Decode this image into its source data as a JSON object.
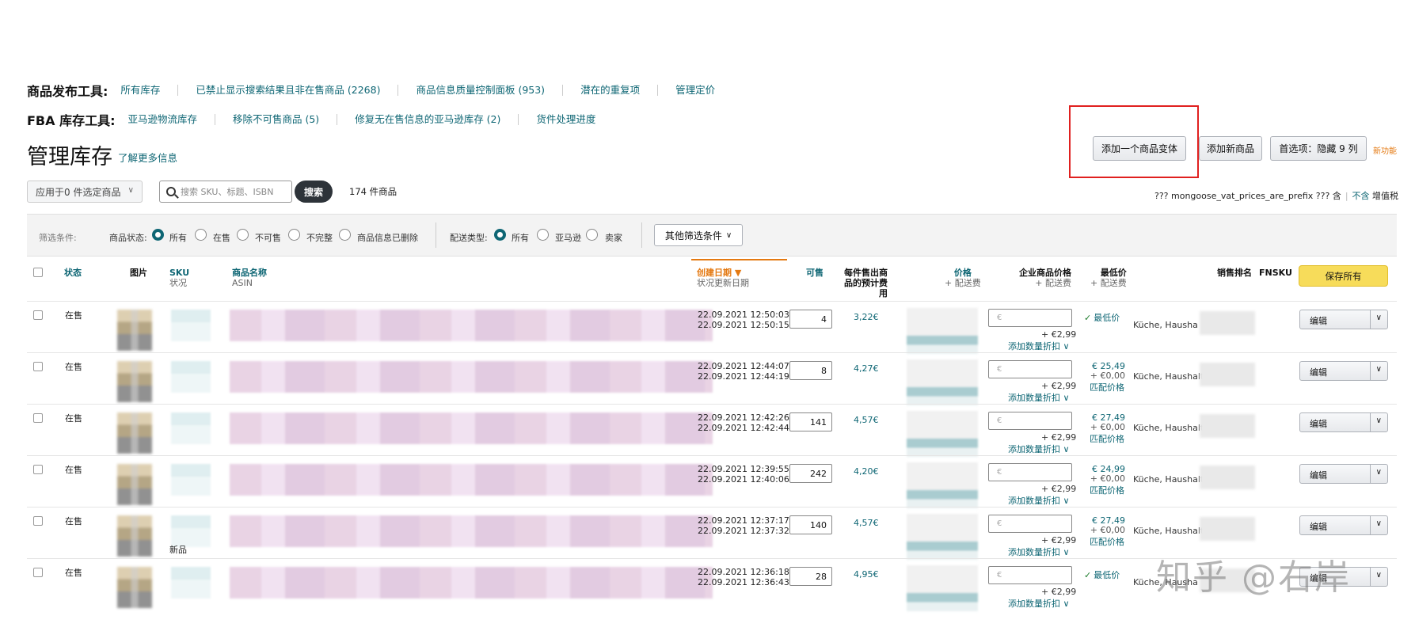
{
  "nav": {
    "row1": {
      "title": "商品发布工具:",
      "links": [
        "所有库存",
        "已禁止显示搜索结果且非在售商品 (2268)",
        "商品信息质量控制面板 (953)",
        "潜在的重复项",
        "管理定价"
      ]
    },
    "row2": {
      "title": "FBA 库存工具:",
      "links": [
        "亚马逊物流库存",
        "移除不可售商品 (5)",
        "修复无在售信息的亚马逊库存 (2)",
        "货件处理进度"
      ]
    }
  },
  "page": {
    "title": "管理库存",
    "learn_more": "了解更多信息"
  },
  "actions": {
    "add_variant": "添加一个商品变体",
    "add_product": "添加新商品",
    "preferences": "首选项：隐藏 9 列",
    "new_feature": "新功能"
  },
  "toolbar": {
    "apply_select": "应用于0 件选定商品",
    "search_placeholder": "搜索 SKU、标题、ISBN",
    "search_button": "搜索",
    "count": "174 件商品",
    "vat_text": "??? mongoose_vat_prices_are_prefix ??? 含",
    "vat_exclude": "不含",
    "vat_suffix": "增值税"
  },
  "filters": {
    "label": "筛选条件:",
    "status_label": "商品状态:",
    "status_options": [
      "所有",
      "在售",
      "不可售",
      "不完整",
      "商品信息已删除"
    ],
    "status_selected": 0,
    "fulfillment_label": "配送类型:",
    "fulfillment_options": [
      "所有",
      "亚马逊",
      "卖家"
    ],
    "fulfillment_selected": 0,
    "more_filters": "其他筛选条件"
  },
  "table": {
    "headers": {
      "status": "状态",
      "image": "图片",
      "sku": "SKU",
      "sku_sub": "状况",
      "name": "商品名称",
      "name_sub": "ASIN",
      "created": "创建日期",
      "created_sub": "状况更新日期",
      "available": "可售",
      "fee_1": "每件售出商",
      "fee_2": "品的预计费",
      "fee_3": "用",
      "price": "价格",
      "price_sub": "+ 配送费",
      "biz_price": "企业商品价格",
      "biz_sub": "+ 配送费",
      "lowest": "最低价",
      "lowest_sub": "+ 配送费",
      "rank": "销售排名",
      "fnsku": "FNSKU",
      "save_all": "保存所有"
    },
    "currency_placeholder": "€",
    "ship": "+ €2,99",
    "discount": "添加数量折扣",
    "edit": "编辑",
    "rows": [
      {
        "status": "在售",
        "created": "22.09.2021 12:50:03",
        "updated": "22.09.2021 12:50:15",
        "qty": "4",
        "fee": "3,22€",
        "lowest_type": "badge",
        "lowest_badge": "最低价",
        "rank": "Küche, Hausha",
        "condition": ""
      },
      {
        "status": "在售",
        "created": "22.09.2021 12:44:07",
        "updated": "22.09.2021 12:44:19",
        "qty": "8",
        "fee": "4,27€",
        "lowest_type": "price",
        "low_price": "€ 25,49",
        "low_ship": "+ €0,00",
        "match": "匹配价格",
        "rank": "Küche, Haushalt",
        "condition": ""
      },
      {
        "status": "在售",
        "created": "22.09.2021 12:42:26",
        "updated": "22.09.2021 12:42:44",
        "qty": "141",
        "fee": "4,57€",
        "lowest_type": "price",
        "low_price": "€ 27,49",
        "low_ship": "+ €0,00",
        "match": "匹配价格",
        "rank": "Küche, Haushalt",
        "condition": ""
      },
      {
        "status": "在售",
        "created": "22.09.2021 12:39:55",
        "updated": "22.09.2021 12:40:06",
        "qty": "242",
        "fee": "4,20€",
        "lowest_type": "price",
        "low_price": "€ 24,99",
        "low_ship": "+ €0,00",
        "match": "匹配价格",
        "rank": "Küche, Haushalt &",
        "condition": ""
      },
      {
        "status": "在售",
        "created": "22.09.2021 12:37:17",
        "updated": "22.09.2021 12:37:32",
        "qty": "140",
        "fee": "4,57€",
        "lowest_type": "price",
        "low_price": "€ 27,49",
        "low_ship": "+ €0,00",
        "match": "匹配价格",
        "rank": "Küche, Haushalt",
        "condition": "新品"
      },
      {
        "status": "在售",
        "created": "22.09.2021 12:36:18",
        "updated": "22.09.2021 12:36:43",
        "qty": "28",
        "fee": "4,95€",
        "lowest_type": "badge",
        "lowest_badge": "最低价",
        "rank": "Küche, Hausha",
        "condition": ""
      }
    ]
  },
  "watermark": "知乎 @右岸"
}
